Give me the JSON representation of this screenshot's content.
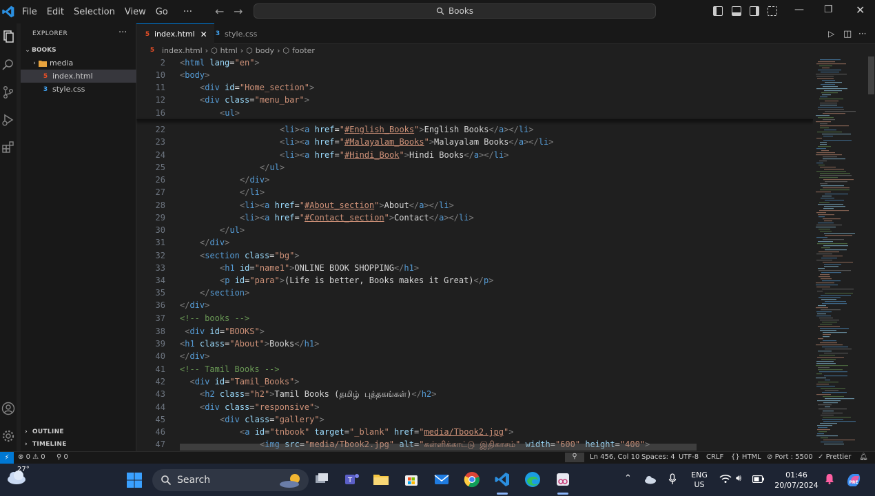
{
  "titlebar": {
    "menus": [
      "File",
      "Edit",
      "Selection",
      "View",
      "Go"
    ],
    "more": "···",
    "search_text": "Books"
  },
  "sidebar": {
    "header": "EXPLORER",
    "more": "···",
    "root": "BOOKS",
    "items": [
      {
        "label": "media",
        "type": "folder"
      },
      {
        "label": "index.html",
        "type": "html",
        "selected": true
      },
      {
        "label": "style.css",
        "type": "css"
      }
    ],
    "outline": "OUTLINE",
    "timeline": "TIMELINE"
  },
  "tabs": [
    {
      "label": "index.html",
      "active": true
    },
    {
      "label": "style.css",
      "active": false
    }
  ],
  "breadcrumb": [
    "index.html",
    "html",
    "body",
    "footer"
  ],
  "code_lines": [
    {
      "n": "2",
      "indent": 0,
      "html": "<span class=\"br\">&lt;</span><span class=\"tag\">html</span> <span class=\"attr\">lang</span><span class=\"txt\">=</span><span class=\"str\">\"en\"</span><span class=\"br\">&gt;</span>"
    },
    {
      "n": "10",
      "indent": 0,
      "html": "<span class=\"br\">&lt;</span><span class=\"tag\">body</span><span class=\"br\">&gt;</span>"
    },
    {
      "n": "11",
      "indent": 4,
      "html": "<span class=\"br\">&lt;</span><span class=\"tag\">div</span> <span class=\"attr\">id</span><span class=\"txt\">=</span><span class=\"str\">\"Home_section\"</span><span class=\"br\">&gt;</span>"
    },
    {
      "n": "12",
      "indent": 4,
      "html": "<span class=\"br\">&lt;</span><span class=\"tag\">div</span> <span class=\"attr\">class</span><span class=\"txt\">=</span><span class=\"str\">\"menu_bar\"</span><span class=\"br\">&gt;</span>"
    },
    {
      "n": "16",
      "indent": 8,
      "html": "<span class=\"br\">&lt;</span><span class=\"tag\">ul</span><span class=\"br\">&gt;</span>"
    },
    {
      "n": "22",
      "indent": 20,
      "html": "<span class=\"br\">&lt;</span><span class=\"tag\">li</span><span class=\"br\">&gt;&lt;</span><span class=\"tag\">a</span> <span class=\"attr\">href</span><span class=\"txt\">=</span><span class=\"str\">\"</span><span class=\"link\">#English_Books</span><span class=\"str\">\"</span><span class=\"br\">&gt;</span><span class=\"txt\">English Books</span><span class=\"br\">&lt;/</span><span class=\"tag\">a</span><span class=\"br\">&gt;&lt;/</span><span class=\"tag\">li</span><span class=\"br\">&gt;</span>"
    },
    {
      "n": "23",
      "indent": 20,
      "html": "<span class=\"br\">&lt;</span><span class=\"tag\">li</span><span class=\"br\">&gt;&lt;</span><span class=\"tag\">a</span> <span class=\"attr\">href</span><span class=\"txt\">=</span><span class=\"str\">\"</span><span class=\"link\">#Malayalam_Books</span><span class=\"str\">\"</span><span class=\"br\">&gt;</span><span class=\"txt\">Malayalam Books</span><span class=\"br\">&lt;/</span><span class=\"tag\">a</span><span class=\"br\">&gt;&lt;/</span><span class=\"tag\">li</span><span class=\"br\">&gt;</span>"
    },
    {
      "n": "24",
      "indent": 20,
      "html": "<span class=\"br\">&lt;</span><span class=\"tag\">li</span><span class=\"br\">&gt;&lt;</span><span class=\"tag\">a</span> <span class=\"attr\">href</span><span class=\"txt\">=</span><span class=\"str\">\"</span><span class=\"link\">#Hindi_Book</span><span class=\"str\">\"</span><span class=\"br\">&gt;</span><span class=\"txt\">Hindi Books</span><span class=\"br\">&lt;/</span><span class=\"tag\">a</span><span class=\"br\">&gt;&lt;/</span><span class=\"tag\">li</span><span class=\"br\">&gt;</span>"
    },
    {
      "n": "25",
      "indent": 16,
      "html": "<span class=\"br\">&lt;/</span><span class=\"tag\">ul</span><span class=\"br\">&gt;</span>"
    },
    {
      "n": "26",
      "indent": 12,
      "html": "<span class=\"br\">&lt;/</span><span class=\"tag\">div</span><span class=\"br\">&gt;</span>"
    },
    {
      "n": "27",
      "indent": 12,
      "html": "<span class=\"br\">&lt;/</span><span class=\"tag\">li</span><span class=\"br\">&gt;</span>"
    },
    {
      "n": "28",
      "indent": 12,
      "html": "<span class=\"br\">&lt;</span><span class=\"tag\">li</span><span class=\"br\">&gt;&lt;</span><span class=\"tag\">a</span> <span class=\"attr\">href</span><span class=\"txt\">=</span><span class=\"str\">\"</span><span class=\"link\">#About_section</span><span class=\"str\">\"</span><span class=\"br\">&gt;</span><span class=\"txt\">About</span><span class=\"br\">&lt;/</span><span class=\"tag\">a</span><span class=\"br\">&gt;&lt;/</span><span class=\"tag\">li</span><span class=\"br\">&gt;</span>"
    },
    {
      "n": "29",
      "indent": 12,
      "html": "<span class=\"br\">&lt;</span><span class=\"tag\">li</span><span class=\"br\">&gt;&lt;</span><span class=\"tag\">a</span> <span class=\"attr\">href</span><span class=\"txt\">=</span><span class=\"str\">\"</span><span class=\"link\">#Contact_section</span><span class=\"str\">\"</span><span class=\"br\">&gt;</span><span class=\"txt\">Contact</span><span class=\"br\">&lt;/</span><span class=\"tag\">a</span><span class=\"br\">&gt;&lt;/</span><span class=\"tag\">li</span><span class=\"br\">&gt;</span>"
    },
    {
      "n": "30",
      "indent": 8,
      "html": "<span class=\"br\">&lt;/</span><span class=\"tag\">ul</span><span class=\"br\">&gt;</span>"
    },
    {
      "n": "31",
      "indent": 4,
      "html": "<span class=\"br\">&lt;/</span><span class=\"tag\">div</span><span class=\"br\">&gt;</span>"
    },
    {
      "n": "32",
      "indent": 4,
      "html": "<span class=\"br\">&lt;</span><span class=\"tag\">section</span> <span class=\"attr\">class</span><span class=\"txt\">=</span><span class=\"str\">\"bg\"</span><span class=\"br\">&gt;</span>"
    },
    {
      "n": "33",
      "indent": 8,
      "html": "<span class=\"br\">&lt;</span><span class=\"tag\">h1</span> <span class=\"attr\">id</span><span class=\"txt\">=</span><span class=\"str\">\"name1\"</span><span class=\"br\">&gt;</span><span class=\"txt\">ONLINE BOOK SHOPPING</span><span class=\"br\">&lt;/</span><span class=\"tag\">h1</span><span class=\"br\">&gt;</span>"
    },
    {
      "n": "34",
      "indent": 8,
      "html": "<span class=\"br\">&lt;</span><span class=\"tag\">p</span> <span class=\"attr\">id</span><span class=\"txt\">=</span><span class=\"str\">\"para\"</span><span class=\"br\">&gt;</span><span class=\"txt\">(Life is better, Books makes it Great)</span><span class=\"br\">&lt;/</span><span class=\"tag\">p</span><span class=\"br\">&gt;</span>"
    },
    {
      "n": "35",
      "indent": 4,
      "html": "<span class=\"br\">&lt;/</span><span class=\"tag\">section</span><span class=\"br\">&gt;</span>"
    },
    {
      "n": "36",
      "indent": 0,
      "html": "<span class=\"br\">&lt;/</span><span class=\"tag\">div</span><span class=\"br\">&gt;</span>"
    },
    {
      "n": "37",
      "indent": 0,
      "html": "<span class=\"cm\">&lt;!-- books --&gt;</span>"
    },
    {
      "n": "38",
      "indent": 1,
      "html": "<span class=\"br\">&lt;</span><span class=\"tag\">div</span> <span class=\"attr\">id</span><span class=\"txt\">=</span><span class=\"str\">\"BOOKS\"</span><span class=\"br\">&gt;</span>"
    },
    {
      "n": "39",
      "indent": 0,
      "html": "<span class=\"br\">&lt;</span><span class=\"tag\">h1</span> <span class=\"attr\">class</span><span class=\"txt\">=</span><span class=\"str\">\"About\"</span><span class=\"br\">&gt;</span><span class=\"txt\">Books</span><span class=\"br\">&lt;/</span><span class=\"tag\">h1</span><span class=\"br\">&gt;</span>"
    },
    {
      "n": "40",
      "indent": 0,
      "html": "<span class=\"br\">&lt;/</span><span class=\"tag\">div</span><span class=\"br\">&gt;</span>"
    },
    {
      "n": "41",
      "indent": 0,
      "html": "<span class=\"cm\">&lt;!-- Tamil Books --&gt;</span>"
    },
    {
      "n": "42",
      "indent": 2,
      "html": "<span class=\"br\">&lt;</span><span class=\"tag\">div</span> <span class=\"attr\">id</span><span class=\"txt\">=</span><span class=\"str\">\"Tamil_Books\"</span><span class=\"br\">&gt;</span>"
    },
    {
      "n": "43",
      "indent": 4,
      "html": "<span class=\"br\">&lt;</span><span class=\"tag\">h2</span> <span class=\"attr\">class</span><span class=\"txt\">=</span><span class=\"str\">\"h2\"</span><span class=\"br\">&gt;</span><span class=\"txt\">Tamil Books (தமிழ் புத்தகங்கள்)</span><span class=\"br\">&lt;/</span><span class=\"tag\">h2</span><span class=\"br\">&gt;</span>"
    },
    {
      "n": "44",
      "indent": 4,
      "html": "<span class=\"br\">&lt;</span><span class=\"tag\">div</span> <span class=\"attr\">class</span><span class=\"txt\">=</span><span class=\"str\">\"responsive\"</span><span class=\"br\">&gt;</span>"
    },
    {
      "n": "45",
      "indent": 8,
      "html": "<span class=\"br\">&lt;</span><span class=\"tag\">div</span> <span class=\"attr\">class</span><span class=\"txt\">=</span><span class=\"str\">\"gallery\"</span><span class=\"br\">&gt;</span>"
    },
    {
      "n": "46",
      "indent": 12,
      "html": "<span class=\"br\">&lt;</span><span class=\"tag\">a</span> <span class=\"attr\">id</span><span class=\"txt\">=</span><span class=\"str\">\"tnbook\"</span> <span class=\"attr\">target</span><span class=\"txt\">=</span><span class=\"str\">\"_blank\"</span> <span class=\"attr\">href</span><span class=\"txt\">=</span><span class=\"str\">\"</span><span class=\"link\">media/Tbook2.jpg</span><span class=\"str\">\"</span><span class=\"br\">&gt;</span>"
    },
    {
      "n": "47",
      "indent": 16,
      "html": "<span class=\"br\">&lt;</span><span class=\"tag\">img</span> <span class=\"attr\">src</span><span class=\"txt\">=</span><span class=\"str\">\"media/Tbook2.jpg\"</span> <span class=\"attr\">alt</span><span class=\"txt\">=</span><span class=\"str\">\"கள்ளிக்காட்டு இதிகாசம்\"</span> <span class=\"attr\">width</span><span class=\"txt\">=</span><span class=\"str\">\"600\"</span> <span class=\"attr\">height</span><span class=\"txt\">=</span><span class=\"str\">\"400\"</span><span class=\"br\">&gt;</span>"
    }
  ],
  "statusbar": {
    "errors": "0",
    "warnings": "0",
    "ports": "0",
    "position": "Ln 456, Col 10",
    "spaces": "Spaces: 4",
    "encoding": "UTF-8",
    "eol": "CRLF",
    "language": "HTML",
    "port": "Port : 5500",
    "prettier": "Prettier"
  },
  "taskbar": {
    "weather": "27°",
    "search": "Search",
    "lang_line1": "ENG",
    "lang_line2": "US",
    "time": "01:46",
    "date": "20/07/2024"
  },
  "colors": {
    "accent": "#0078d4",
    "tag": "#569cd6",
    "attr": "#9cdcfe",
    "string": "#ce9178",
    "comment": "#6a9955",
    "html_icon": "#e44d26",
    "css_icon": "#42a5f5"
  }
}
